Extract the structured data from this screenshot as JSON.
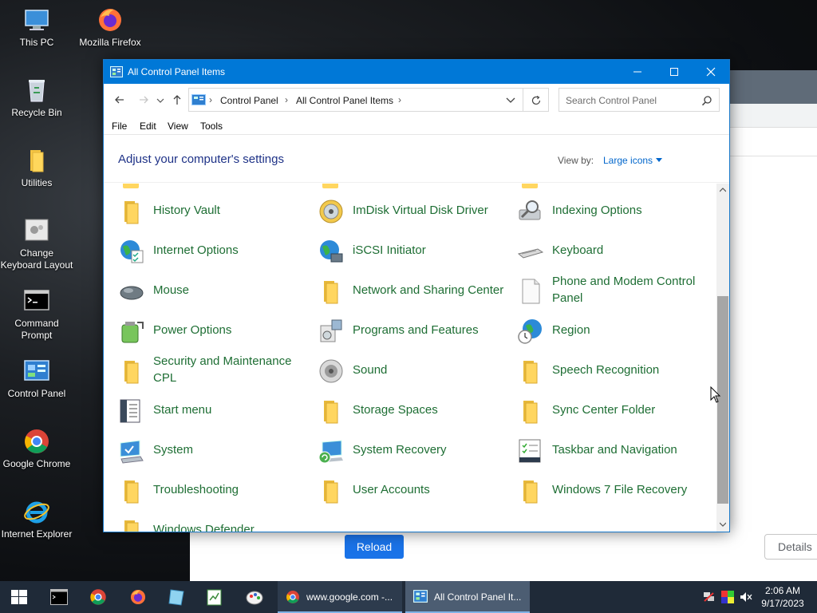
{
  "desktop": {
    "icons": [
      {
        "label": "This PC",
        "icon": "computer-icon"
      },
      {
        "label": "Mozilla Firefox",
        "icon": "firefox-icon"
      },
      {
        "label": "Recycle Bin",
        "icon": "recycle-bin-icon"
      },
      {
        "label": "Utilities",
        "icon": "folder-icon"
      },
      {
        "label": "Change Keyboard Layout",
        "icon": "keyboard-layout-icon"
      },
      {
        "label": "Command Prompt",
        "icon": "cmd-icon"
      },
      {
        "label": "Control Panel",
        "icon": "control-panel-icon"
      },
      {
        "label": "Google Chrome",
        "icon": "chrome-icon"
      },
      {
        "label": "Internet Explorer",
        "icon": "ie-icon"
      }
    ]
  },
  "background_window": {
    "reload_label": "Reload",
    "details_label": "Details"
  },
  "window": {
    "title": "All Control Panel Items",
    "breadcrumb": [
      "Control Panel",
      "All Control Panel Items"
    ],
    "search_placeholder": "Search Control Panel",
    "menu": [
      "File",
      "Edit",
      "View",
      "Tools"
    ],
    "heading": "Adjust your computer's settings",
    "view_by_label": "View by:",
    "view_by_value": "Large icons",
    "items": [
      {
        "label": "History Vault",
        "icon": "folder-icon"
      },
      {
        "label": "ImDisk Virtual Disk Driver",
        "icon": "disk-icon"
      },
      {
        "label": "Indexing Options",
        "icon": "indexing-icon"
      },
      {
        "label": "Internet Options",
        "icon": "internet-options-icon"
      },
      {
        "label": "iSCSI Initiator",
        "icon": "iscsi-icon"
      },
      {
        "label": "Keyboard",
        "icon": "keyboard-icon"
      },
      {
        "label": "Mouse",
        "icon": "mouse-icon"
      },
      {
        "label": "Network and Sharing Center",
        "icon": "folder-icon"
      },
      {
        "label": "Phone and Modem Control Panel",
        "icon": "document-icon"
      },
      {
        "label": "Power Options",
        "icon": "power-icon"
      },
      {
        "label": "Programs and Features",
        "icon": "programs-icon"
      },
      {
        "label": "Region",
        "icon": "region-icon"
      },
      {
        "label": "Security and Maintenance CPL",
        "icon": "folder-icon"
      },
      {
        "label": "Sound",
        "icon": "sound-icon"
      },
      {
        "label": "Speech Recognition",
        "icon": "folder-icon"
      },
      {
        "label": "Start menu",
        "icon": "start-menu-icon"
      },
      {
        "label": "Storage Spaces",
        "icon": "folder-icon"
      },
      {
        "label": "Sync Center Folder",
        "icon": "folder-icon"
      },
      {
        "label": "System",
        "icon": "system-icon"
      },
      {
        "label": "System Recovery",
        "icon": "system-recovery-icon"
      },
      {
        "label": "Taskbar and Navigation",
        "icon": "taskbar-icon"
      },
      {
        "label": "Troubleshooting",
        "icon": "folder-icon"
      },
      {
        "label": "User Accounts",
        "icon": "folder-icon"
      },
      {
        "label": "Windows 7 File Recovery",
        "icon": "folder-icon"
      },
      {
        "label": "Windows Defender",
        "icon": "folder-icon"
      }
    ]
  },
  "taskbar": {
    "tasks": [
      {
        "label": "www.google.com -...",
        "icon": "chrome-icon"
      },
      {
        "label": "All Control Panel It...",
        "icon": "control-panel-icon"
      }
    ],
    "time": "2:06 AM",
    "date": "9/17/2023"
  },
  "colors": {
    "titlebar": "#0078d7",
    "item_text": "#1e6e34",
    "heading": "#1e3287",
    "taskbar": "#1f2a38",
    "reload_button": "#1a73e8"
  }
}
